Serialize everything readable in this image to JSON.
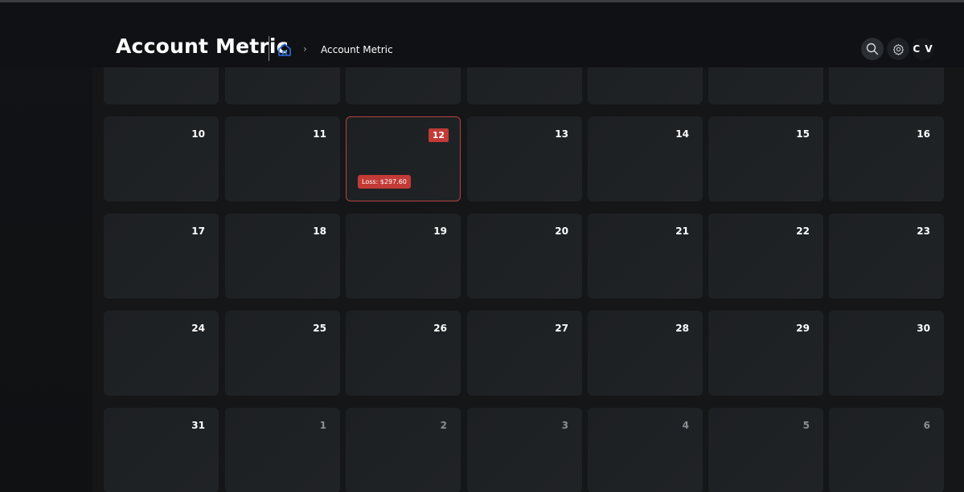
{
  "header": {
    "title": "Account Metric",
    "breadcrumb": {
      "home_icon": "home-icon",
      "separator": "›",
      "current": "Account Metric"
    },
    "search_icon": "search-icon",
    "settings_icon": "gear-icon",
    "avatar_initials": "C V"
  },
  "colors": {
    "background": "#0e1013",
    "cell": "#1e2124",
    "loss": "#c23b36",
    "home_icon": "#2f6fe0"
  },
  "calendar": {
    "weeks": [
      [
        {
          "day": "",
          "dim": false
        },
        {
          "day": "",
          "dim": false
        },
        {
          "day": "",
          "dim": false
        },
        {
          "day": "",
          "dim": false
        },
        {
          "day": "",
          "dim": false
        },
        {
          "day": "",
          "dim": false
        },
        {
          "day": "",
          "dim": false
        }
      ],
      [
        {
          "day": "10",
          "dim": false
        },
        {
          "day": "11",
          "dim": false
        },
        {
          "day": "12",
          "dim": false,
          "selected": true,
          "pnl": "Loss: $297.60"
        },
        {
          "day": "13",
          "dim": false
        },
        {
          "day": "14",
          "dim": false
        },
        {
          "day": "15",
          "dim": false
        },
        {
          "day": "16",
          "dim": false
        }
      ],
      [
        {
          "day": "17",
          "dim": false
        },
        {
          "day": "18",
          "dim": false
        },
        {
          "day": "19",
          "dim": false
        },
        {
          "day": "20",
          "dim": false
        },
        {
          "day": "21",
          "dim": false
        },
        {
          "day": "22",
          "dim": false
        },
        {
          "day": "23",
          "dim": false
        }
      ],
      [
        {
          "day": "24",
          "dim": false
        },
        {
          "day": "25",
          "dim": false
        },
        {
          "day": "26",
          "dim": false
        },
        {
          "day": "27",
          "dim": false
        },
        {
          "day": "28",
          "dim": false
        },
        {
          "day": "29",
          "dim": false
        },
        {
          "day": "30",
          "dim": false
        }
      ],
      [
        {
          "day": "31",
          "dim": false
        },
        {
          "day": "1",
          "dim": true
        },
        {
          "day": "2",
          "dim": true
        },
        {
          "day": "3",
          "dim": true
        },
        {
          "day": "4",
          "dim": true
        },
        {
          "day": "5",
          "dim": true
        },
        {
          "day": "6",
          "dim": true
        }
      ]
    ]
  }
}
